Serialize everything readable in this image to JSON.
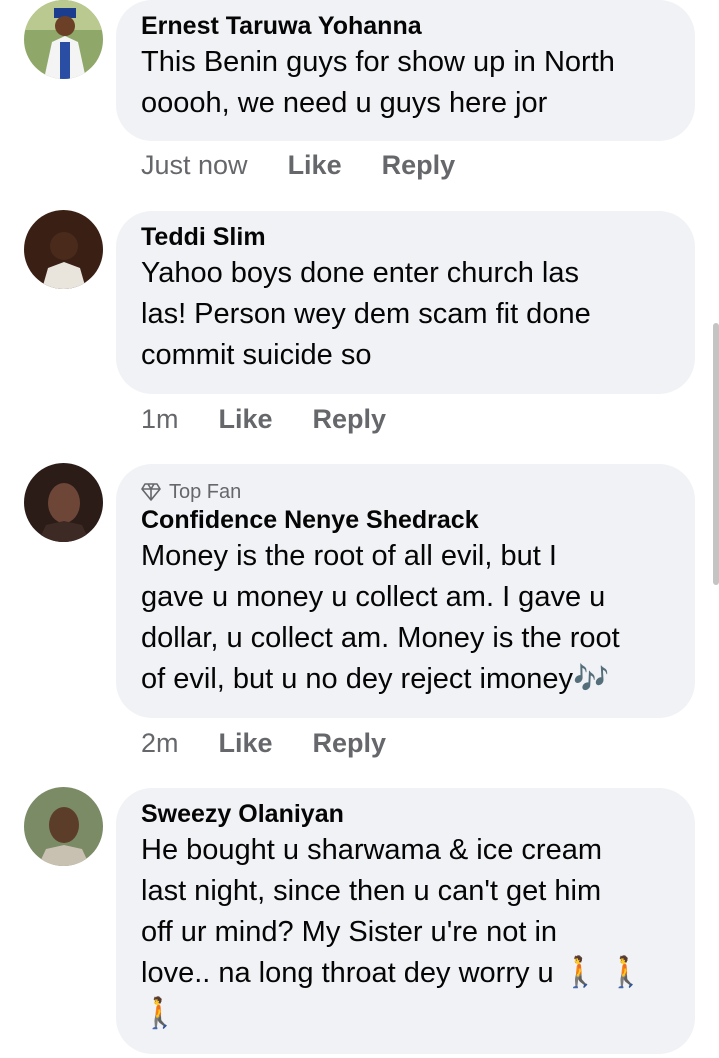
{
  "comments": [
    {
      "author": "Ernest Taruwa Yohanna",
      "text": "This Benin guys for show up in North\nooooh, we need u guys here jor",
      "time": "Just now",
      "like": "Like",
      "reply": "Reply"
    },
    {
      "author": "Teddi Slim",
      "text": "Yahoo boys done enter church las\nlas! Person wey dem scam fit done\ncommit suicide so",
      "time": "1m",
      "like": "Like",
      "reply": "Reply"
    },
    {
      "badge": "Top Fan",
      "author": "Confidence Nenye Shedrack",
      "text": "Money is the root of all evil, but I\ngave u money u collect am. I gave u\ndollar, u collect am. Money is the root\nof evil, but u no dey reject imoney",
      "emoji": "🎶",
      "time": "2m",
      "like": "Like",
      "reply": "Reply"
    },
    {
      "author": "Sweezy Olaniyan",
      "text": "He bought u sharwama & ice cream\nlast night, since then u can't get him\noff ur mind? My Sister u're not in\nlove.. na long throat dey worry u",
      "emoji": "🚶",
      "icons": {
        "walk": "person-walking-icon",
        "music": "musical-notes-icon",
        "badge": "diamond-icon"
      }
    }
  ],
  "colors": {
    "bubble": "#f0f2f5",
    "meta": "#65676b",
    "text": "#050505"
  }
}
